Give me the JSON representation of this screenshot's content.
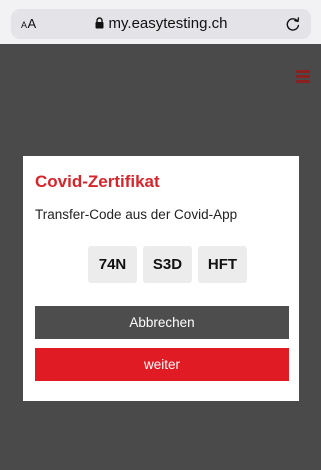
{
  "browser": {
    "text_size_label_small": "A",
    "text_size_label_large": "A",
    "url": "my.easytesting.ch"
  },
  "modal": {
    "title": "Covid-Zertifikat",
    "subtitle": "Transfer-Code aus der Covid-App",
    "codes": [
      "74N",
      "S3D",
      "HFT"
    ],
    "cancel_label": "Abbrechen",
    "next_label": "weiter"
  },
  "colors": {
    "accent": "#e01b24",
    "title": "#d8242b",
    "cancel_button": "#4d4d4d",
    "overlay": "#4a4a4a"
  },
  "icons": {
    "lock": "lock-icon",
    "reload": "reload-icon",
    "menu": "hamburger-icon"
  }
}
